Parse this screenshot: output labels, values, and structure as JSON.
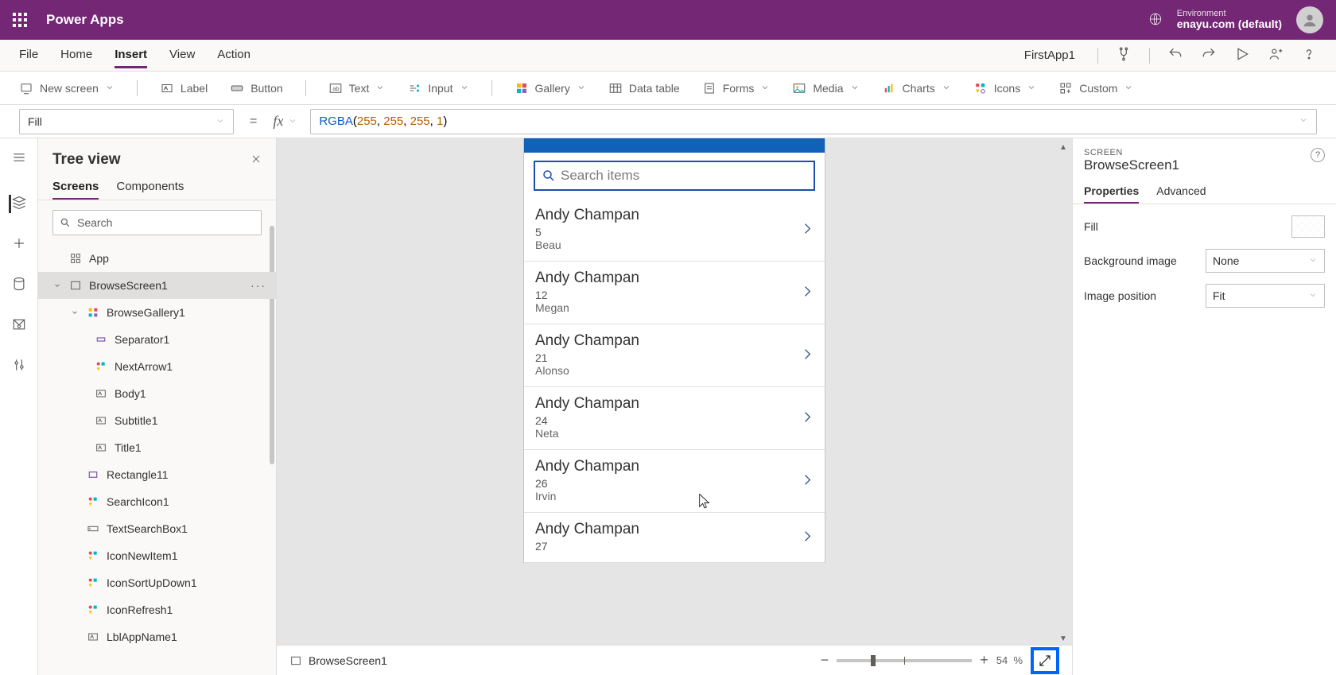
{
  "title_bar": {
    "app_title": "Power Apps",
    "env_label": "Environment",
    "env_value": "enayu.com (default)"
  },
  "menu": {
    "items": [
      "File",
      "Home",
      "Insert",
      "View",
      "Action"
    ],
    "active": "Insert",
    "app_name": "FirstApp1"
  },
  "ribbon": {
    "new_screen": "New screen",
    "label": "Label",
    "button": "Button",
    "text": "Text",
    "input": "Input",
    "gallery": "Gallery",
    "data_table": "Data table",
    "forms": "Forms",
    "media": "Media",
    "charts": "Charts",
    "icons": "Icons",
    "custom": "Custom"
  },
  "formula": {
    "property": "Fill",
    "fx": "fx",
    "func": "RGBA",
    "args": [
      "255",
      "255",
      "255",
      "1"
    ]
  },
  "tree": {
    "title": "Tree view",
    "tabs": [
      "Screens",
      "Components"
    ],
    "active_tab": "Screens",
    "search_placeholder": "Search",
    "nodes": {
      "app": "App",
      "browse_screen": "BrowseScreen1",
      "browse_gallery": "BrowseGallery1",
      "separator": "Separator1",
      "next_arrow": "NextArrow1",
      "body": "Body1",
      "subtitle": "Subtitle1",
      "title": "Title1",
      "rectangle": "Rectangle11",
      "search_icon": "SearchIcon1",
      "text_search": "TextSearchBox1",
      "icon_new": "IconNewItem1",
      "icon_sort": "IconSortUpDown1",
      "icon_refresh": "IconRefresh1",
      "lbl_app_name": "LblAppName1"
    }
  },
  "canvas": {
    "search_placeholder": "Search items",
    "records": [
      {
        "title": "Andy Champan",
        "subtitle": "5",
        "body": "Beau"
      },
      {
        "title": "Andy Champan",
        "subtitle": "12",
        "body": "Megan"
      },
      {
        "title": "Andy Champan",
        "subtitle": "21",
        "body": "Alonso"
      },
      {
        "title": "Andy Champan",
        "subtitle": "24",
        "body": "Neta"
      },
      {
        "title": "Andy Champan",
        "subtitle": "26",
        "body": "Irvin"
      },
      {
        "title": "Andy Champan",
        "subtitle": "27",
        "body": ""
      }
    ]
  },
  "status_bar": {
    "screen": "BrowseScreen1",
    "zoom": "54",
    "zoom_unit": "%"
  },
  "props": {
    "kind": "SCREEN",
    "object": "BrowseScreen1",
    "tabs": [
      "Properties",
      "Advanced"
    ],
    "active_tab": "Properties",
    "rows": {
      "fill": "Fill",
      "bg_image": "Background image",
      "bg_image_value": "None",
      "image_pos": "Image position",
      "image_pos_value": "Fit"
    }
  }
}
